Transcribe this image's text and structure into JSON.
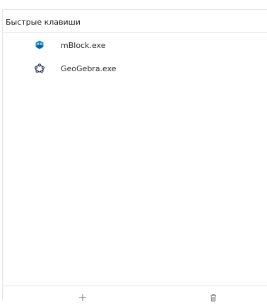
{
  "shortcuts_panel": {
    "title": "Быстрые клавиши",
    "items": [
      {
        "label": "mBlock.exe",
        "icon": "mblock-app-icon",
        "icon_color": "#1d8fce"
      },
      {
        "label": "GeoGebra.exe",
        "icon": "geogebra-app-icon",
        "icon_color": "#333333"
      }
    ],
    "footer": {
      "add_icon": "plus-icon",
      "delete_icon": "trash-icon"
    }
  },
  "colors": {
    "border": "#e6e6e6",
    "text": "#1a1a1a",
    "icon_muted": "#707070"
  }
}
